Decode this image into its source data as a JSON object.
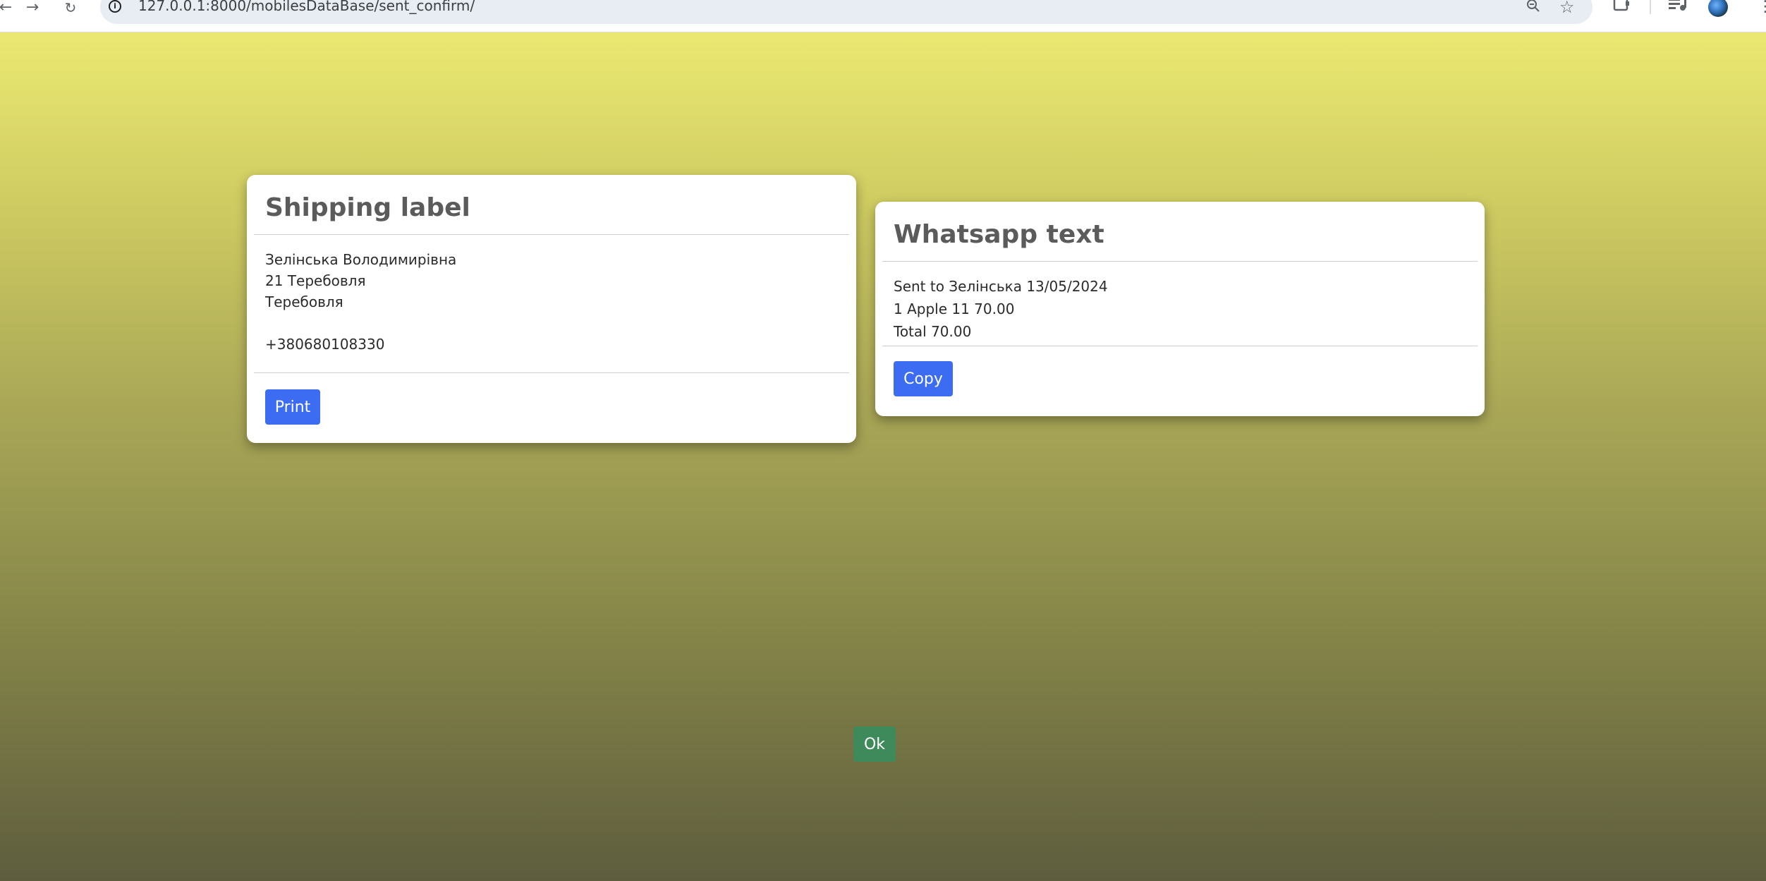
{
  "browser": {
    "url": "127.0.0.1:8000/mobilesDataBase/sent_confirm/"
  },
  "shipping_card": {
    "title": "Shipping label",
    "name": "Зелінська Володимирівна",
    "address_line1": "21 Теребовля",
    "address_line2": "Теребовля",
    "phone": "+380680108330",
    "print_label": "Print"
  },
  "whatsapp_card": {
    "title": "Whatsapp text",
    "line1": "Sent to Зелінська 13/05/2024",
    "line2": "1 Apple 11 70.00",
    "line3": "Total 70.00",
    "copy_label": "Copy"
  },
  "ok_label": "Ok",
  "colors": {
    "primary_button": "#3b6cf1",
    "ok_button": "#3e8a5a",
    "gradient_top": "#ebe972",
    "gradient_bottom": "#5e5d3e"
  }
}
